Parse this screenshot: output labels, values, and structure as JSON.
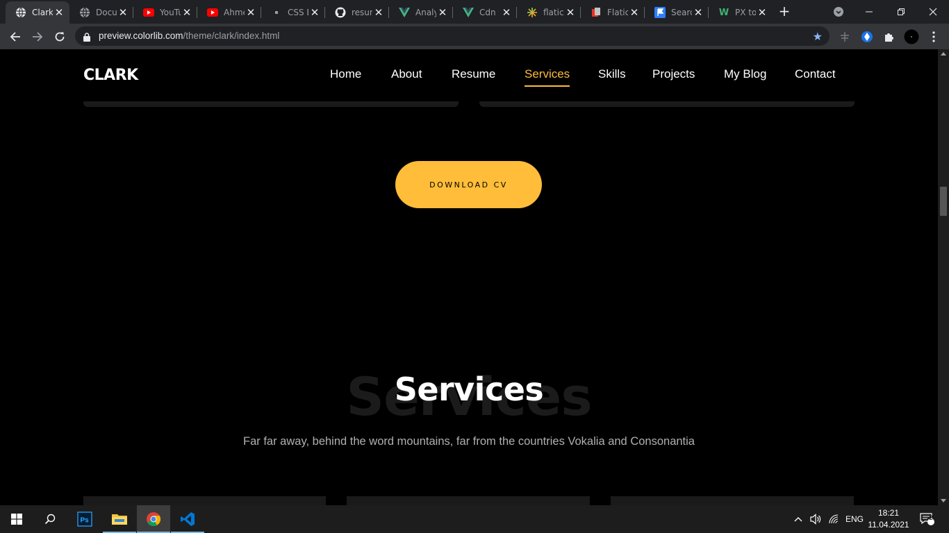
{
  "browser": {
    "tabs": [
      {
        "title": "Clark",
        "icon": "globe-icon",
        "active": true
      },
      {
        "title": "Docu",
        "icon": "globe-icon"
      },
      {
        "title": "YouTu",
        "icon": "youtube-icon"
      },
      {
        "title": "Ahme",
        "icon": "youtube-icon"
      },
      {
        "title": "CSS B",
        "icon": "dot-icon"
      },
      {
        "title": "resum",
        "icon": "github-icon"
      },
      {
        "title": "Analy",
        "icon": "vue-icon"
      },
      {
        "title": "Cdn",
        "icon": "vue-icon"
      },
      {
        "title": "flatic",
        "icon": "flaticon-icon"
      },
      {
        "title": "Flatic",
        "icon": "flaticon-red-icon"
      },
      {
        "title": "Searc",
        "icon": "flag-icon"
      },
      {
        "title": "PX to",
        "icon": "w-icon"
      }
    ],
    "url_host": "preview.colorlib.com",
    "url_path": "/theme/clark/index.html"
  },
  "site": {
    "logo": "CLARK",
    "nav": [
      "Home",
      "About",
      "Resume",
      "Services",
      "Skills",
      "Projects",
      "My Blog",
      "Contact"
    ],
    "active_nav": "Services",
    "download_button": "DOWNLOAD CV",
    "section_bg_title": "Services",
    "section_title": "Services",
    "section_subtitle": "Far far away, behind the word mountains, far from the countries Vokalia and Consonantia"
  },
  "taskbar": {
    "apps": [
      "windows-start-icon",
      "search-icon",
      "photoshop-icon",
      "file-explorer-icon",
      "chrome-icon",
      "vscode-icon"
    ],
    "active_app": "chrome-icon",
    "language": "ENG",
    "time": "18:21",
    "date": "11.04.2021",
    "notifications": "2"
  },
  "colors": {
    "accent": "#ffbd39",
    "page_bg": "#000000",
    "chrome_dark": "#202124",
    "toolbar": "#35363a"
  }
}
